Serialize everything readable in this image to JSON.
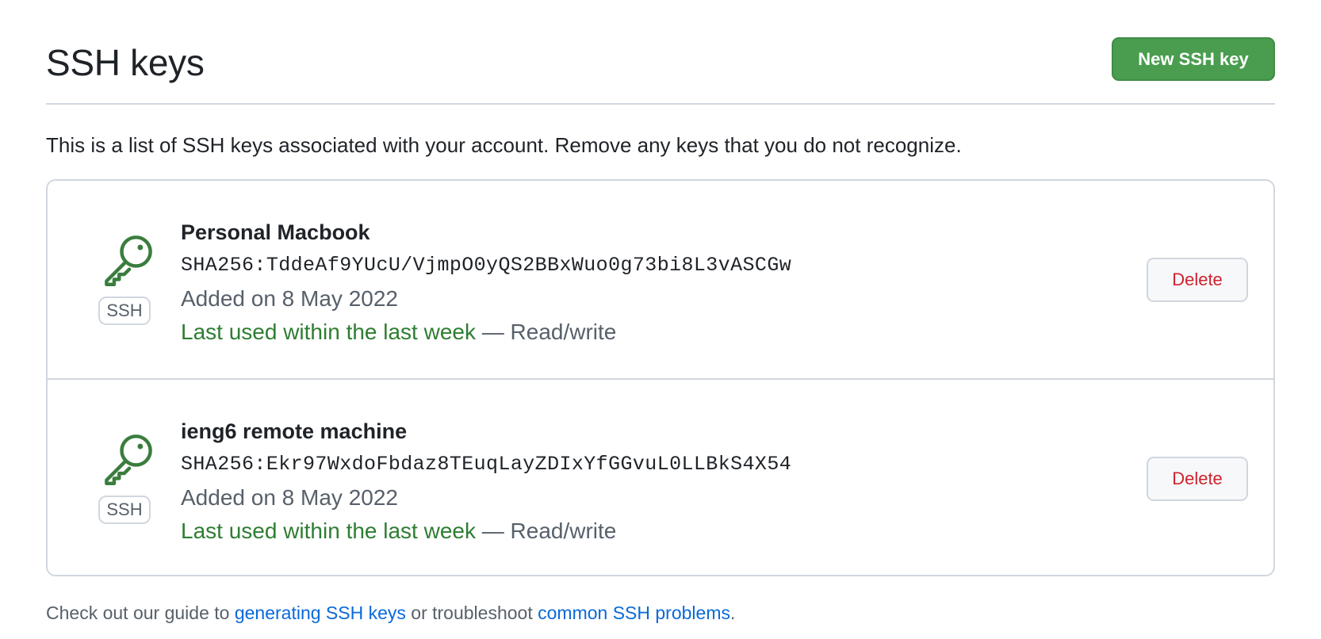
{
  "header": {
    "title": "SSH keys",
    "new_key_label": "New SSH key"
  },
  "intro": "This is a list of SSH keys associated with your account. Remove any keys that you do not recognize.",
  "keys": [
    {
      "title": "Personal Macbook",
      "fingerprint": "SHA256:TddeAf9YUcU/VjmpO0yQS2BBxWuo0g73bi8L3vASCGw",
      "added": "Added on 8 May 2022",
      "last_used": "Last used within the last week",
      "access": " — Read/write",
      "badge": "SSH",
      "delete_label": "Delete",
      "icon": "key-icon"
    },
    {
      "title": "ieng6 remote machine",
      "fingerprint": "SHA256:Ekr97WxdoFbdaz8TEuqLayZDIxYfGGvuL0LLBkS4X54",
      "added": "Added on 8 May 2022",
      "last_used": "Last used within the last week",
      "access": " — Read/write",
      "badge": "SSH",
      "delete_label": "Delete",
      "icon": "key-icon"
    }
  ],
  "footer": {
    "prefix": "Check out our guide to ",
    "link1": "generating SSH keys",
    "middle": " or troubleshoot ",
    "link2": "common SSH problems",
    "suffix": "."
  },
  "colors": {
    "primary_button": "#4a9d4f",
    "danger_text": "#cf222e",
    "success_text": "#2e7d32",
    "link": "#0969da"
  }
}
